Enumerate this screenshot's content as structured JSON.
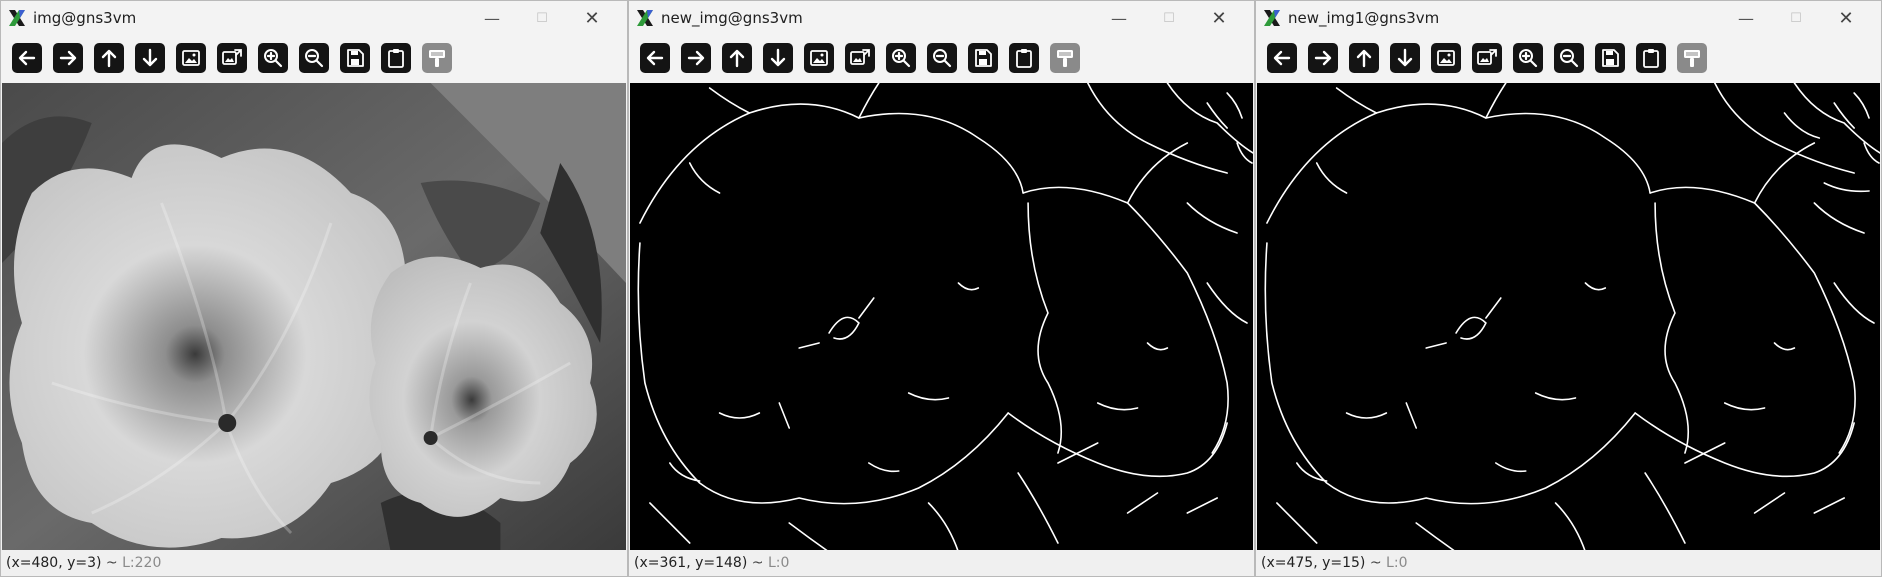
{
  "toolbar_buttons": [
    {
      "id": "pan-left",
      "icon": "arrow-left-icon"
    },
    {
      "id": "pan-right",
      "icon": "arrow-right-icon"
    },
    {
      "id": "pan-up",
      "icon": "arrow-up-icon"
    },
    {
      "id": "pan-down",
      "icon": "arrow-down-icon"
    },
    {
      "id": "zoom-fit",
      "icon": "zoom-fit-image-icon"
    },
    {
      "id": "zoom-original",
      "icon": "zoom-original-image-icon"
    },
    {
      "id": "zoom-in",
      "icon": "zoom-in-icon"
    },
    {
      "id": "zoom-out",
      "icon": "zoom-out-icon"
    },
    {
      "id": "save",
      "icon": "save-icon"
    },
    {
      "id": "copy",
      "icon": "clipboard-icon"
    },
    {
      "id": "properties",
      "icon": "properties-icon",
      "enabled": false
    }
  ],
  "windows": [
    {
      "title": "img@gns3vm",
      "coords": "(x=480, y=3)",
      "separator": " ~ ",
      "level": "L:220",
      "content": "grayscale-photo"
    },
    {
      "title": "new_img@gns3vm",
      "coords": "(x=361, y=148)",
      "separator": " ~ ",
      "level": "L:0",
      "content": "edge-map"
    },
    {
      "title": "new_img1@gns3vm",
      "coords": "(x=475, y=15)",
      "separator": " ~ ",
      "level": "L:0",
      "content": "edge-map"
    }
  ],
  "window_controls": {
    "minimize": "—",
    "maximize": "☐",
    "close": "✕"
  },
  "colors": {
    "edges": "#ffffff",
    "background": "#000000",
    "toolbar_button": "#141414",
    "toolbar_button_disabled": "#8a8a8a"
  }
}
